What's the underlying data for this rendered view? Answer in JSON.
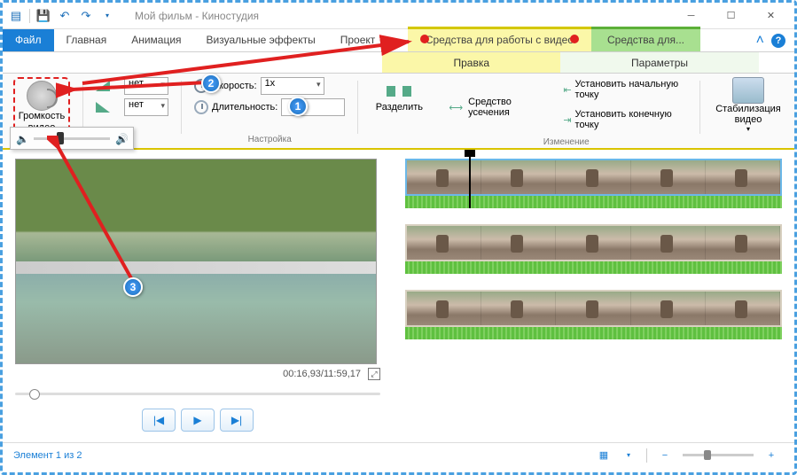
{
  "title": "Мой фильм - Киностудия",
  "tabs": {
    "file": "Файл",
    "home": "Главная",
    "animation": "Анимация",
    "visual_fx": "Визуальные эффекты",
    "project": "Проект",
    "context_video": "Средства для работы с видео",
    "context_extra": "Средства для...",
    "sub_edit": "Правка",
    "sub_params": "Параметры"
  },
  "ribbon": {
    "volume": {
      "label": "Громкость видео"
    },
    "fade_in_label": "нет",
    "fade_out_label": "нет",
    "speed_label": "Скорость:",
    "speed_value": "1x",
    "duration_label": "Длительность:",
    "duration_value": "",
    "group_settings": "Настройка",
    "split": "Разделить",
    "trim": "Средство усечения",
    "set_start": "Установить начальную точку",
    "set_end": "Установить конечную точку",
    "group_edit": "Изменение",
    "stabilize": "Стабилизация видео"
  },
  "preview": {
    "time": "00:16,93/11:59,17"
  },
  "status": {
    "text": "Элемент 1 из 2"
  },
  "callouts": {
    "c1": "1",
    "c2": "2",
    "c3": "3"
  }
}
